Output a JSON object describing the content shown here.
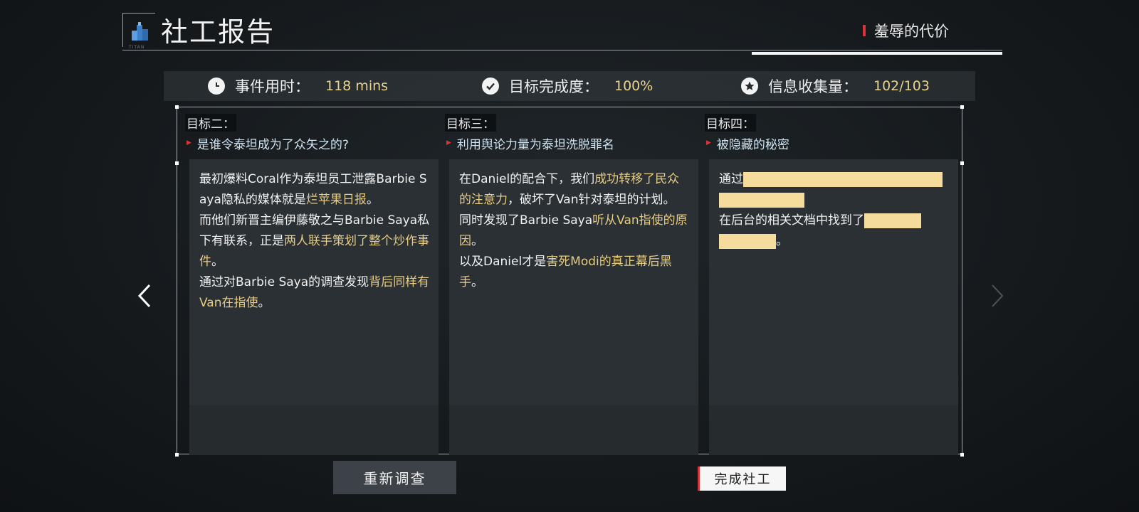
{
  "header": {
    "logo_text": "TITAN",
    "title": "社工报告",
    "chapter": "羞辱的代价"
  },
  "stats": [
    {
      "icon": "clock-icon",
      "label": "事件用时：",
      "value": "118 mins"
    },
    {
      "icon": "check-circle-icon",
      "label": "目标完成度：",
      "value": "100%"
    },
    {
      "icon": "star-circle-icon",
      "label": "信息收集量：",
      "value": "102/103"
    }
  ],
  "goals": [
    {
      "title": "目标二：",
      "subtitle": "是谁令泰坦成为了众矢之的?",
      "body": {
        "p1a": "最初爆料Coral作为泰坦员工泄露Barbie Saya隐私的媒体就是",
        "p1b": "烂苹果日报",
        "p1c": "。",
        "p2a": "而他们新晋主编伊藤敬之与Barbie Saya私下有联系，正是",
        "p2b": "两人联手策划了整个炒作事件",
        "p2c": "。",
        "p3a": "通过对Barbie Saya的调查发现",
        "p3b": "背后同样有Van在指使",
        "p3c": "。"
      }
    },
    {
      "title": "目标三：",
      "subtitle": "利用舆论力量为泰坦洗脱罪名",
      "body": {
        "p1a": "在Daniel的配合下，我们",
        "p1b": "成功转移了民众的注意力",
        "p1c": "，破坏了Van针对泰坦的计划。",
        "p2a": "同时发现了Barbie Saya",
        "p2b": "听从Van指使的原因",
        "p2c": "。",
        "p3a": "以及Daniel才是",
        "p3b": "害死Modi的真正幕后黑手",
        "p3c": "。"
      }
    },
    {
      "title": "目标四：",
      "subtitle": "被隐藏的秘密",
      "body": {
        "p1a": "通过",
        "p2a": "在后台的相关文档中找到了",
        "p2c": "。"
      }
    }
  ],
  "buttons": {
    "reinvestigate": "重新调查",
    "complete": "完成社工"
  },
  "colors": {
    "accent_red": "#d8343a",
    "highlight": "#e7cd84",
    "redaction": "#f5dc9c"
  }
}
